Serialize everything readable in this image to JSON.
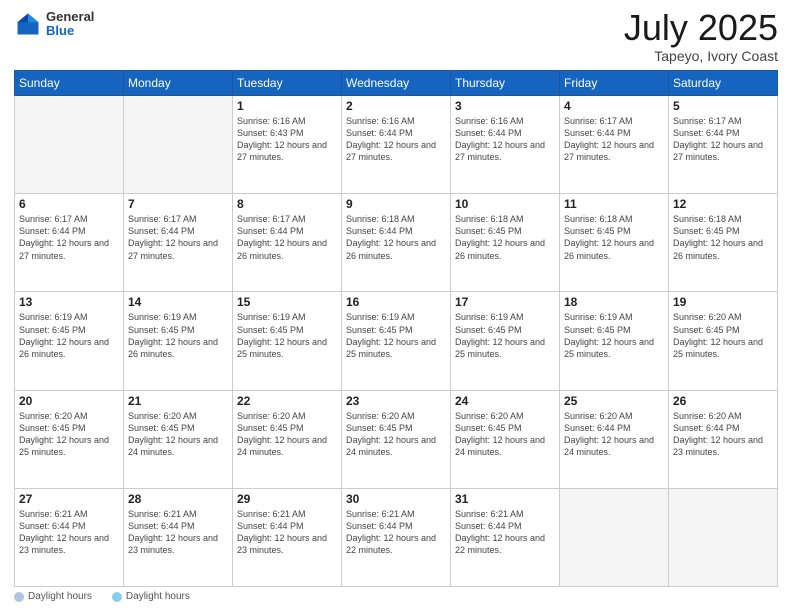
{
  "header": {
    "logo_general": "General",
    "logo_blue": "Blue",
    "title": "July 2025",
    "location": "Tapeyo, Ivory Coast"
  },
  "weekdays": [
    "Sunday",
    "Monday",
    "Tuesday",
    "Wednesday",
    "Thursday",
    "Friday",
    "Saturday"
  ],
  "weeks": [
    [
      {
        "day": "",
        "sunrise": "",
        "sunset": "",
        "daylight": ""
      },
      {
        "day": "",
        "sunrise": "",
        "sunset": "",
        "daylight": ""
      },
      {
        "day": "1",
        "sunrise": "Sunrise: 6:16 AM",
        "sunset": "Sunset: 6:43 PM",
        "daylight": "Daylight: 12 hours and 27 minutes."
      },
      {
        "day": "2",
        "sunrise": "Sunrise: 6:16 AM",
        "sunset": "Sunset: 6:44 PM",
        "daylight": "Daylight: 12 hours and 27 minutes."
      },
      {
        "day": "3",
        "sunrise": "Sunrise: 6:16 AM",
        "sunset": "Sunset: 6:44 PM",
        "daylight": "Daylight: 12 hours and 27 minutes."
      },
      {
        "day": "4",
        "sunrise": "Sunrise: 6:17 AM",
        "sunset": "Sunset: 6:44 PM",
        "daylight": "Daylight: 12 hours and 27 minutes."
      },
      {
        "day": "5",
        "sunrise": "Sunrise: 6:17 AM",
        "sunset": "Sunset: 6:44 PM",
        "daylight": "Daylight: 12 hours and 27 minutes."
      }
    ],
    [
      {
        "day": "6",
        "sunrise": "Sunrise: 6:17 AM",
        "sunset": "Sunset: 6:44 PM",
        "daylight": "Daylight: 12 hours and 27 minutes."
      },
      {
        "day": "7",
        "sunrise": "Sunrise: 6:17 AM",
        "sunset": "Sunset: 6:44 PM",
        "daylight": "Daylight: 12 hours and 27 minutes."
      },
      {
        "day": "8",
        "sunrise": "Sunrise: 6:17 AM",
        "sunset": "Sunset: 6:44 PM",
        "daylight": "Daylight: 12 hours and 26 minutes."
      },
      {
        "day": "9",
        "sunrise": "Sunrise: 6:18 AM",
        "sunset": "Sunset: 6:44 PM",
        "daylight": "Daylight: 12 hours and 26 minutes."
      },
      {
        "day": "10",
        "sunrise": "Sunrise: 6:18 AM",
        "sunset": "Sunset: 6:45 PM",
        "daylight": "Daylight: 12 hours and 26 minutes."
      },
      {
        "day": "11",
        "sunrise": "Sunrise: 6:18 AM",
        "sunset": "Sunset: 6:45 PM",
        "daylight": "Daylight: 12 hours and 26 minutes."
      },
      {
        "day": "12",
        "sunrise": "Sunrise: 6:18 AM",
        "sunset": "Sunset: 6:45 PM",
        "daylight": "Daylight: 12 hours and 26 minutes."
      }
    ],
    [
      {
        "day": "13",
        "sunrise": "Sunrise: 6:19 AM",
        "sunset": "Sunset: 6:45 PM",
        "daylight": "Daylight: 12 hours and 26 minutes."
      },
      {
        "day": "14",
        "sunrise": "Sunrise: 6:19 AM",
        "sunset": "Sunset: 6:45 PM",
        "daylight": "Daylight: 12 hours and 26 minutes."
      },
      {
        "day": "15",
        "sunrise": "Sunrise: 6:19 AM",
        "sunset": "Sunset: 6:45 PM",
        "daylight": "Daylight: 12 hours and 25 minutes."
      },
      {
        "day": "16",
        "sunrise": "Sunrise: 6:19 AM",
        "sunset": "Sunset: 6:45 PM",
        "daylight": "Daylight: 12 hours and 25 minutes."
      },
      {
        "day": "17",
        "sunrise": "Sunrise: 6:19 AM",
        "sunset": "Sunset: 6:45 PM",
        "daylight": "Daylight: 12 hours and 25 minutes."
      },
      {
        "day": "18",
        "sunrise": "Sunrise: 6:19 AM",
        "sunset": "Sunset: 6:45 PM",
        "daylight": "Daylight: 12 hours and 25 minutes."
      },
      {
        "day": "19",
        "sunrise": "Sunrise: 6:20 AM",
        "sunset": "Sunset: 6:45 PM",
        "daylight": "Daylight: 12 hours and 25 minutes."
      }
    ],
    [
      {
        "day": "20",
        "sunrise": "Sunrise: 6:20 AM",
        "sunset": "Sunset: 6:45 PM",
        "daylight": "Daylight: 12 hours and 25 minutes."
      },
      {
        "day": "21",
        "sunrise": "Sunrise: 6:20 AM",
        "sunset": "Sunset: 6:45 PM",
        "daylight": "Daylight: 12 hours and 24 minutes."
      },
      {
        "day": "22",
        "sunrise": "Sunrise: 6:20 AM",
        "sunset": "Sunset: 6:45 PM",
        "daylight": "Daylight: 12 hours and 24 minutes."
      },
      {
        "day": "23",
        "sunrise": "Sunrise: 6:20 AM",
        "sunset": "Sunset: 6:45 PM",
        "daylight": "Daylight: 12 hours and 24 minutes."
      },
      {
        "day": "24",
        "sunrise": "Sunrise: 6:20 AM",
        "sunset": "Sunset: 6:45 PM",
        "daylight": "Daylight: 12 hours and 24 minutes."
      },
      {
        "day": "25",
        "sunrise": "Sunrise: 6:20 AM",
        "sunset": "Sunset: 6:44 PM",
        "daylight": "Daylight: 12 hours and 24 minutes."
      },
      {
        "day": "26",
        "sunrise": "Sunrise: 6:20 AM",
        "sunset": "Sunset: 6:44 PM",
        "daylight": "Daylight: 12 hours and 23 minutes."
      }
    ],
    [
      {
        "day": "27",
        "sunrise": "Sunrise: 6:21 AM",
        "sunset": "Sunset: 6:44 PM",
        "daylight": "Daylight: 12 hours and 23 minutes."
      },
      {
        "day": "28",
        "sunrise": "Sunrise: 6:21 AM",
        "sunset": "Sunset: 6:44 PM",
        "daylight": "Daylight: 12 hours and 23 minutes."
      },
      {
        "day": "29",
        "sunrise": "Sunrise: 6:21 AM",
        "sunset": "Sunset: 6:44 PM",
        "daylight": "Daylight: 12 hours and 23 minutes."
      },
      {
        "day": "30",
        "sunrise": "Sunrise: 6:21 AM",
        "sunset": "Sunset: 6:44 PM",
        "daylight": "Daylight: 12 hours and 22 minutes."
      },
      {
        "day": "31",
        "sunrise": "Sunrise: 6:21 AM",
        "sunset": "Sunset: 6:44 PM",
        "daylight": "Daylight: 12 hours and 22 minutes."
      },
      {
        "day": "",
        "sunrise": "",
        "sunset": "",
        "daylight": ""
      },
      {
        "day": "",
        "sunrise": "",
        "sunset": "",
        "daylight": ""
      }
    ]
  ],
  "footer": {
    "daylight_label": "Daylight hours",
    "daylight_label2": "Daylight hours"
  }
}
